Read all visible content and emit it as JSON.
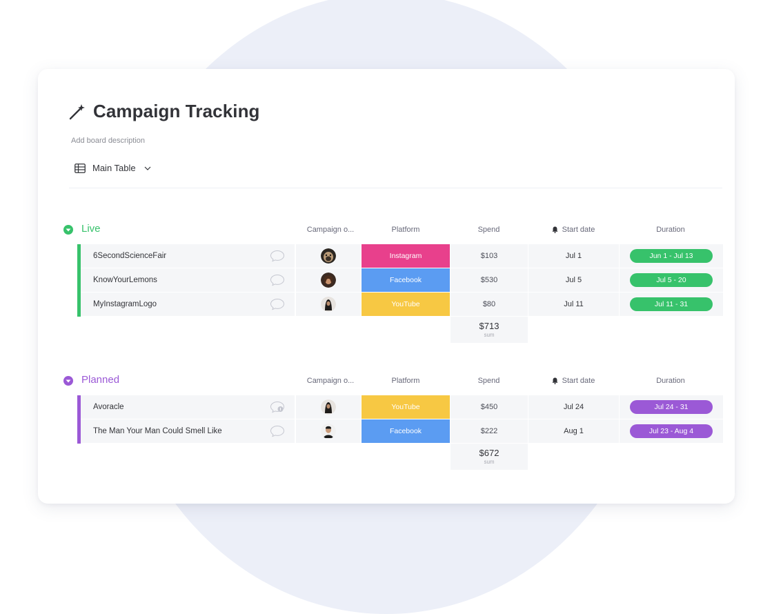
{
  "board": {
    "title": "Campaign Tracking",
    "description": "Add board description",
    "view_label": "Main Table"
  },
  "columns": {
    "owner": "Campaign o...",
    "platform": "Platform",
    "spend": "Spend",
    "start": "Start date",
    "duration": "Duration"
  },
  "colors": {
    "live": "#37c26b",
    "planned": "#9b59d6",
    "instagram": "#e8408c",
    "facebook": "#5b9cf2",
    "youtube": "#f7c843"
  },
  "groups": [
    {
      "name": "Live",
      "color": "#37c26b",
      "rows": [
        {
          "item": "6SecondScienceFair",
          "owner_icon": "dog-avatar",
          "platform": "Instagram",
          "platform_color": "#e8408c",
          "spend": "$103",
          "start": "Jul 1",
          "duration": "Jun 1 - Jul 13"
        },
        {
          "item": "KnowYourLemons",
          "owner_icon": "woman-avatar",
          "platform": "Facebook",
          "platform_color": "#5b9cf2",
          "spend": "$530",
          "start": "Jul 5",
          "duration": "Jul 5 - 20"
        },
        {
          "item": "MyInstagramLogo",
          "owner_icon": "woman-avatar",
          "platform": "YouTube",
          "platform_color": "#f7c843",
          "spend": "$80",
          "start": "Jul 11",
          "duration": "Jul 11 - 31"
        }
      ],
      "sum_value": "$713",
      "sum_label": "sum"
    },
    {
      "name": "Planned",
      "color": "#9b59d6",
      "rows": [
        {
          "item": "Avoracle",
          "owner_icon": "woman-avatar",
          "platform": "YouTube",
          "platform_color": "#f7c843",
          "spend": "$450",
          "start": "Jul 24",
          "duration": "Jul 24 - 31"
        },
        {
          "item": "The Man Your Man Could Smell Like",
          "owner_icon": "man-avatar",
          "platform": "Facebook",
          "platform_color": "#5b9cf2",
          "spend": "$222",
          "start": "Aug 1",
          "duration": "Jul 23 - Aug 4"
        }
      ],
      "sum_value": "$672",
      "sum_label": "sum"
    }
  ]
}
